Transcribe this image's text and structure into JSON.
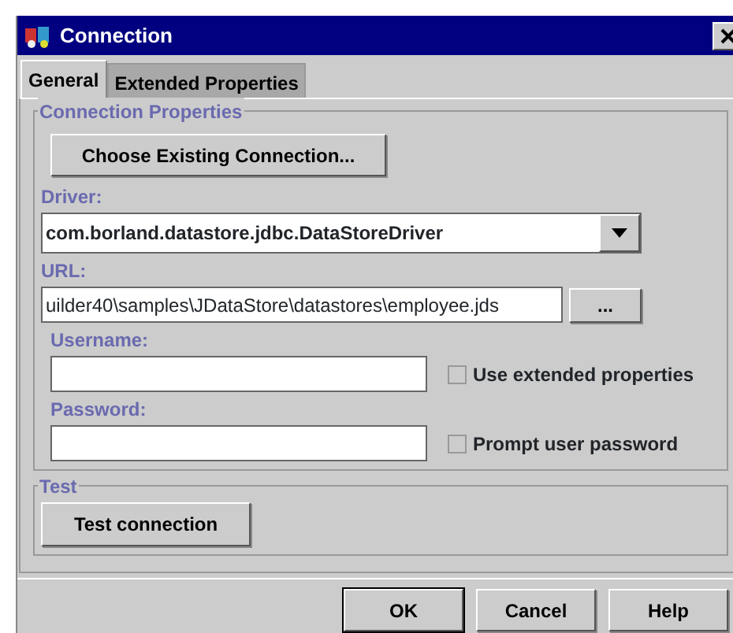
{
  "window": {
    "title": "Connection"
  },
  "tabs": [
    {
      "label": "General",
      "selected": true
    },
    {
      "label": "Extended Properties",
      "selected": false
    }
  ],
  "connection_properties": {
    "legend": "Connection Properties",
    "choose_button": "Choose Existing Connection...",
    "driver_label": "Driver:",
    "driver_value": "com.borland.datastore.jdbc.DataStoreDriver",
    "url_label": "URL:",
    "url_value": "uilder40\\samples\\JDataStore\\datastores\\employee.jds",
    "browse_button": "...",
    "username_label": "Username:",
    "password_label": "Password:",
    "checkboxes": [
      {
        "label": "Use extended properties",
        "checked": false
      },
      {
        "label": "Prompt user password",
        "checked": false
      }
    ]
  },
  "test": {
    "legend": "Test",
    "button": "Test connection"
  },
  "buttons": [
    {
      "label": "OK",
      "default": true
    },
    {
      "label": "Cancel",
      "default": false
    },
    {
      "label": "Help",
      "default": false
    }
  ]
}
